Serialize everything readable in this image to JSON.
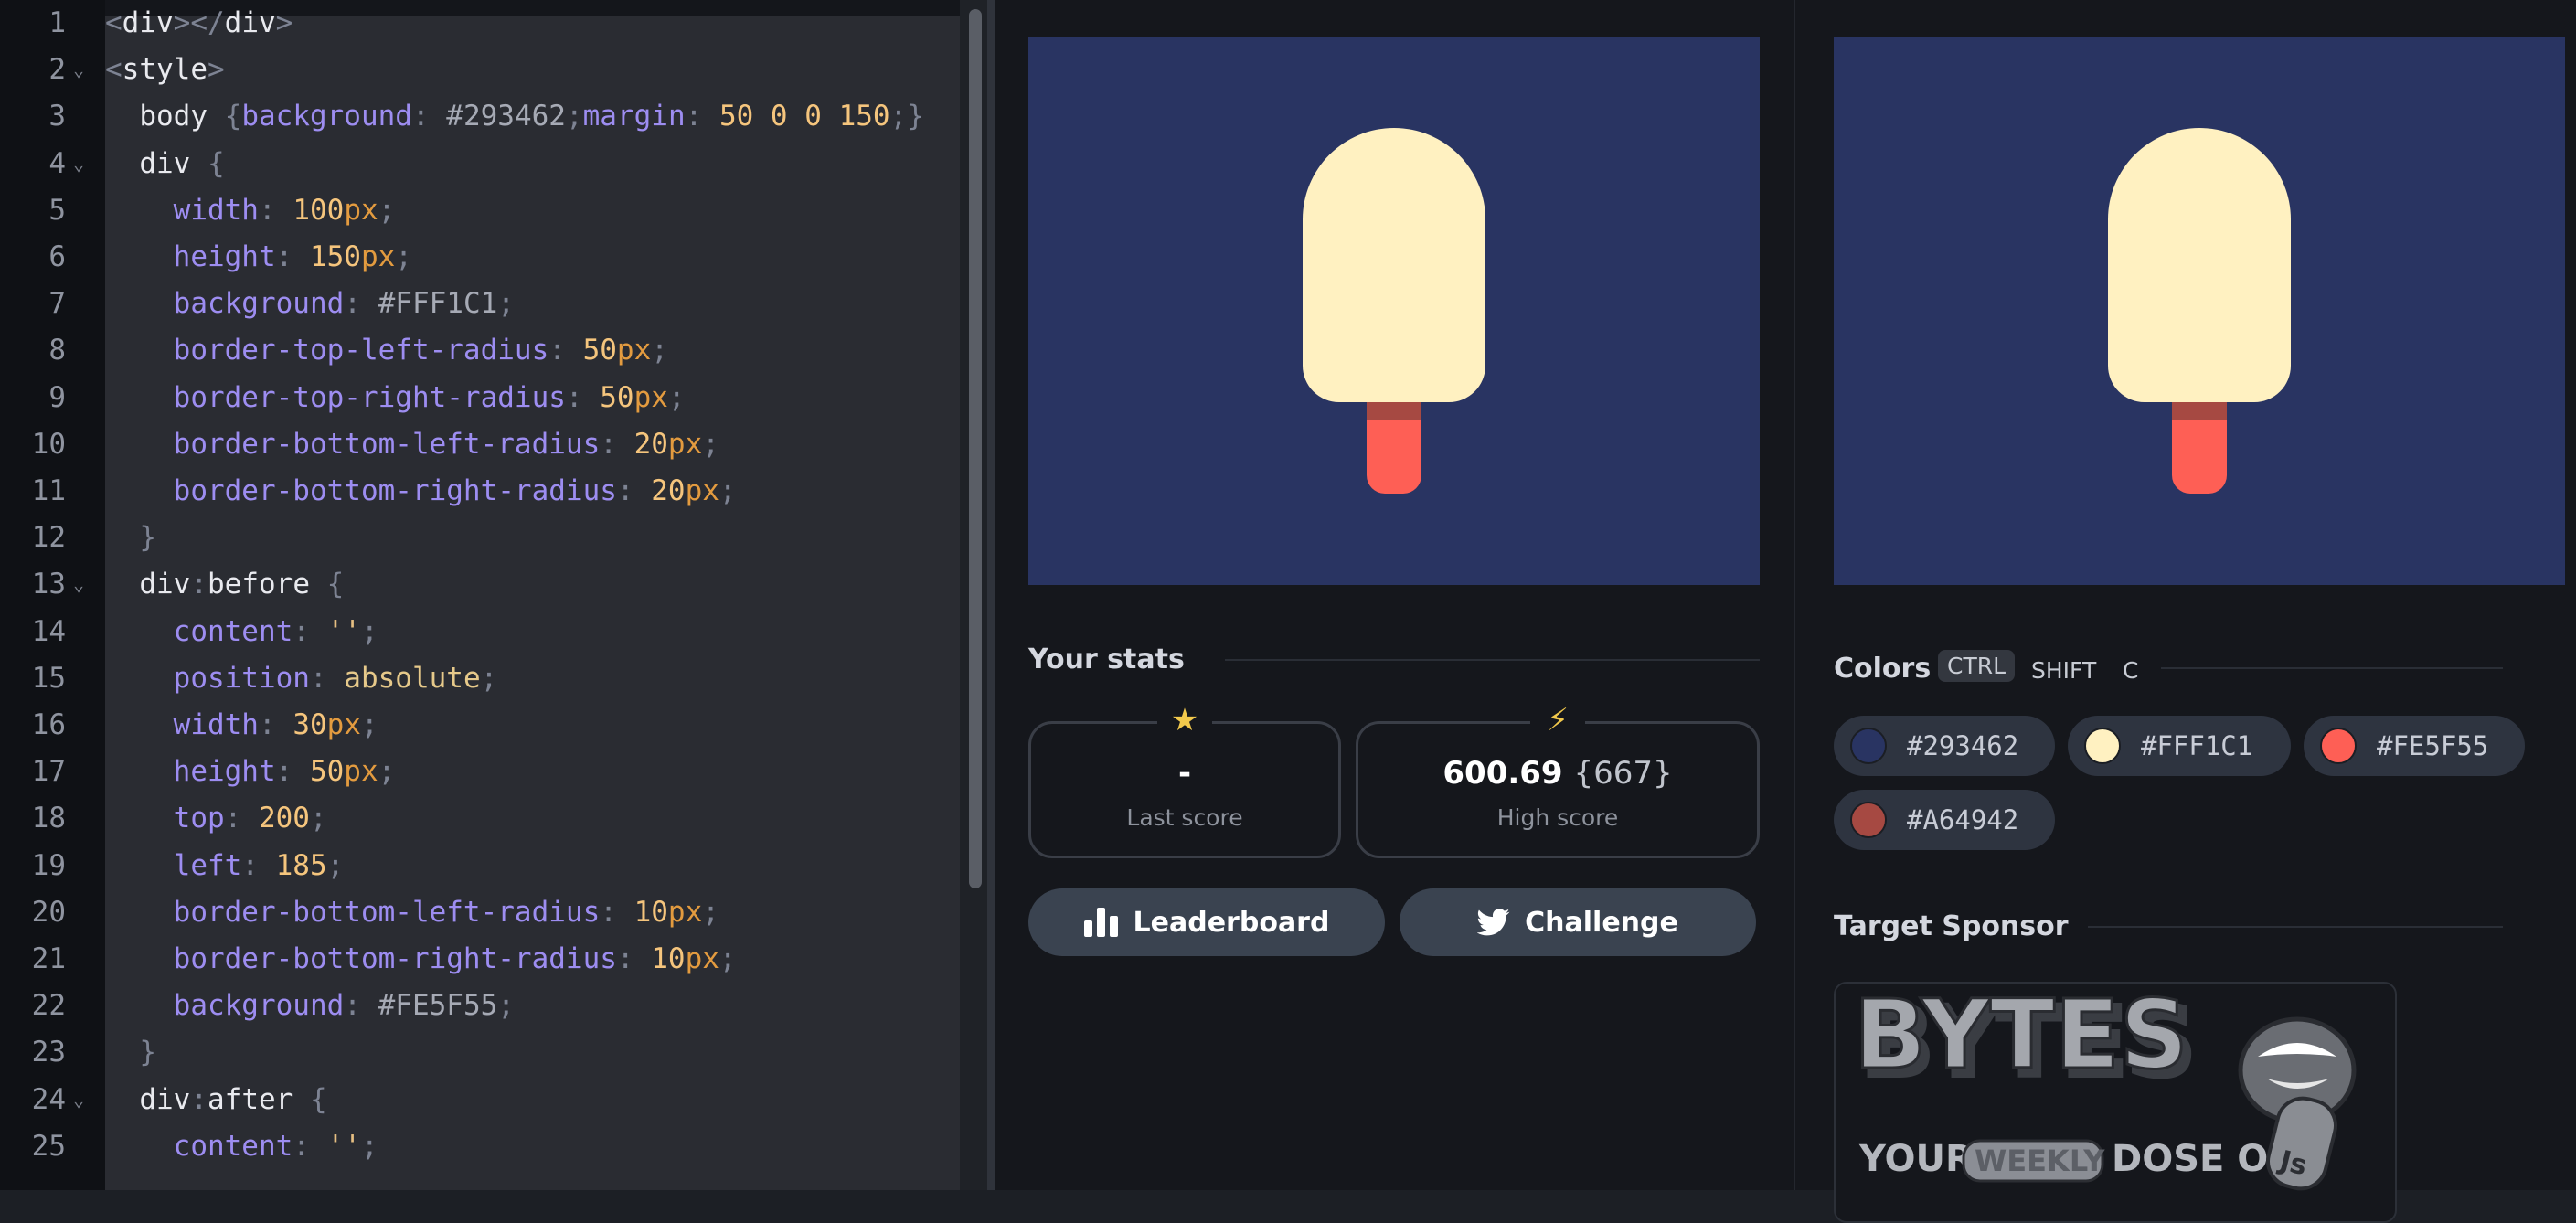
{
  "editor": {
    "lines": [
      {
        "n": "1",
        "fold": false,
        "tokens": [
          [
            "p",
            "<"
          ],
          [
            "sel",
            "div"
          ],
          [
            "p",
            "></"
          ],
          [
            "sel",
            "div"
          ],
          [
            "p",
            ">"
          ]
        ]
      },
      {
        "n": "2",
        "fold": true,
        "tokens": [
          [
            "p",
            "<"
          ],
          [
            "sel",
            "style"
          ],
          [
            "p",
            ">"
          ]
        ]
      },
      {
        "n": "3",
        "fold": false,
        "tokens": [
          [
            "sel",
            "  body "
          ],
          [
            "p",
            "{"
          ],
          [
            "prop",
            "background"
          ],
          [
            "p",
            ": "
          ],
          [
            "hex",
            "#293462"
          ],
          [
            "p",
            ";"
          ],
          [
            "prop",
            "margin"
          ],
          [
            "p",
            ": "
          ],
          [
            "num",
            "50 0 0 150"
          ],
          [
            "p",
            ";}"
          ]
        ]
      },
      {
        "n": "4",
        "fold": true,
        "tokens": [
          [
            "sel",
            "  div "
          ],
          [
            "p",
            "{"
          ]
        ]
      },
      {
        "n": "5",
        "fold": false,
        "tokens": [
          [
            "prop",
            "    width"
          ],
          [
            "p",
            ": "
          ],
          [
            "num",
            "100"
          ],
          [
            "unit",
            "px"
          ],
          [
            "p",
            ";"
          ]
        ]
      },
      {
        "n": "6",
        "fold": false,
        "tokens": [
          [
            "prop",
            "    height"
          ],
          [
            "p",
            ": "
          ],
          [
            "num",
            "150"
          ],
          [
            "unit",
            "px"
          ],
          [
            "p",
            ";"
          ]
        ]
      },
      {
        "n": "7",
        "fold": false,
        "tokens": [
          [
            "prop",
            "    background"
          ],
          [
            "p",
            ": "
          ],
          [
            "hex",
            "#FFF1C1"
          ],
          [
            "p",
            ";"
          ]
        ]
      },
      {
        "n": "8",
        "fold": false,
        "tokens": [
          [
            "prop",
            "    border-top-left-radius"
          ],
          [
            "p",
            ": "
          ],
          [
            "num",
            "50"
          ],
          [
            "unit",
            "px"
          ],
          [
            "p",
            ";"
          ]
        ]
      },
      {
        "n": "9",
        "fold": false,
        "tokens": [
          [
            "prop",
            "    border-top-right-radius"
          ],
          [
            "p",
            ": "
          ],
          [
            "num",
            "50"
          ],
          [
            "unit",
            "px"
          ],
          [
            "p",
            ";"
          ]
        ]
      },
      {
        "n": "10",
        "fold": false,
        "tokens": [
          [
            "prop",
            "    border-bottom-left-radius"
          ],
          [
            "p",
            ": "
          ],
          [
            "num",
            "20"
          ],
          [
            "unit",
            "px"
          ],
          [
            "p",
            ";"
          ]
        ]
      },
      {
        "n": "11",
        "fold": false,
        "tokens": [
          [
            "prop",
            "    border-bottom-right-radius"
          ],
          [
            "p",
            ": "
          ],
          [
            "num",
            "20"
          ],
          [
            "unit",
            "px"
          ],
          [
            "p",
            ";"
          ]
        ]
      },
      {
        "n": "12",
        "fold": false,
        "tokens": [
          [
            "p",
            "  }"
          ]
        ]
      },
      {
        "n": "13",
        "fold": true,
        "tokens": [
          [
            "sel",
            "  div"
          ],
          [
            "p",
            ":"
          ],
          [
            "sel",
            "before "
          ],
          [
            "p",
            "{"
          ]
        ]
      },
      {
        "n": "14",
        "fold": false,
        "tokens": [
          [
            "prop",
            "    content"
          ],
          [
            "p",
            ": "
          ],
          [
            "str",
            "''"
          ],
          [
            "p",
            ";"
          ]
        ]
      },
      {
        "n": "15",
        "fold": false,
        "tokens": [
          [
            "prop",
            "    position"
          ],
          [
            "p",
            ": "
          ],
          [
            "kw",
            "absolute"
          ],
          [
            "p",
            ";"
          ]
        ]
      },
      {
        "n": "16",
        "fold": false,
        "tokens": [
          [
            "prop",
            "    width"
          ],
          [
            "p",
            ": "
          ],
          [
            "num",
            "30"
          ],
          [
            "unit",
            "px"
          ],
          [
            "p",
            ";"
          ]
        ]
      },
      {
        "n": "17",
        "fold": false,
        "tokens": [
          [
            "prop",
            "    height"
          ],
          [
            "p",
            ": "
          ],
          [
            "num",
            "50"
          ],
          [
            "unit",
            "px"
          ],
          [
            "p",
            ";"
          ]
        ]
      },
      {
        "n": "18",
        "fold": false,
        "tokens": [
          [
            "prop",
            "    top"
          ],
          [
            "p",
            ": "
          ],
          [
            "num",
            "200"
          ],
          [
            "p",
            ";"
          ]
        ]
      },
      {
        "n": "19",
        "fold": false,
        "tokens": [
          [
            "prop",
            "    left"
          ],
          [
            "p",
            ": "
          ],
          [
            "num",
            "185"
          ],
          [
            "p",
            ";"
          ]
        ]
      },
      {
        "n": "20",
        "fold": false,
        "tokens": [
          [
            "prop",
            "    border-bottom-left-radius"
          ],
          [
            "p",
            ": "
          ],
          [
            "num",
            "10"
          ],
          [
            "unit",
            "px"
          ],
          [
            "p",
            ";"
          ]
        ]
      },
      {
        "n": "21",
        "fold": false,
        "tokens": [
          [
            "prop",
            "    border-bottom-right-radius"
          ],
          [
            "p",
            ": "
          ],
          [
            "num",
            "10"
          ],
          [
            "unit",
            "px"
          ],
          [
            "p",
            ";"
          ]
        ]
      },
      {
        "n": "22",
        "fold": false,
        "tokens": [
          [
            "prop",
            "    background"
          ],
          [
            "p",
            ": "
          ],
          [
            "hex",
            "#FE5F55"
          ],
          [
            "p",
            ";"
          ]
        ]
      },
      {
        "n": "23",
        "fold": false,
        "tokens": [
          [
            "p",
            "  }"
          ]
        ]
      },
      {
        "n": "24",
        "fold": true,
        "tokens": [
          [
            "sel",
            "  div"
          ],
          [
            "p",
            ":"
          ],
          [
            "sel",
            "after "
          ],
          [
            "p",
            "{"
          ]
        ]
      },
      {
        "n": "25",
        "fold": false,
        "tokens": [
          [
            "prop",
            "    content"
          ],
          [
            "p",
            ": "
          ],
          [
            "str",
            "''"
          ],
          [
            "p",
            ";"
          ]
        ]
      }
    ]
  },
  "stats": {
    "title": "Your stats",
    "last_score": {
      "icon": "star-icon",
      "value": "-",
      "label": "Last score"
    },
    "high_score": {
      "icon": "lightning-icon",
      "value": "600.69",
      "sub": "{667}",
      "label": "High score"
    }
  },
  "buttons": {
    "leaderboard": "Leaderboard",
    "challenge": "Challenge"
  },
  "colors": {
    "title": "Colors",
    "shortcut": [
      "CTRL",
      "SHIFT",
      "C"
    ],
    "palette": [
      "#293462",
      "#FFF1C1",
      "#FE5F55",
      "#A64942"
    ]
  },
  "sponsor": {
    "title": "Target Sponsor",
    "logo_text": "BYTES",
    "tagline": [
      "YOUR",
      "WEEKLY",
      "DOSE OF"
    ],
    "badge": "JS"
  }
}
